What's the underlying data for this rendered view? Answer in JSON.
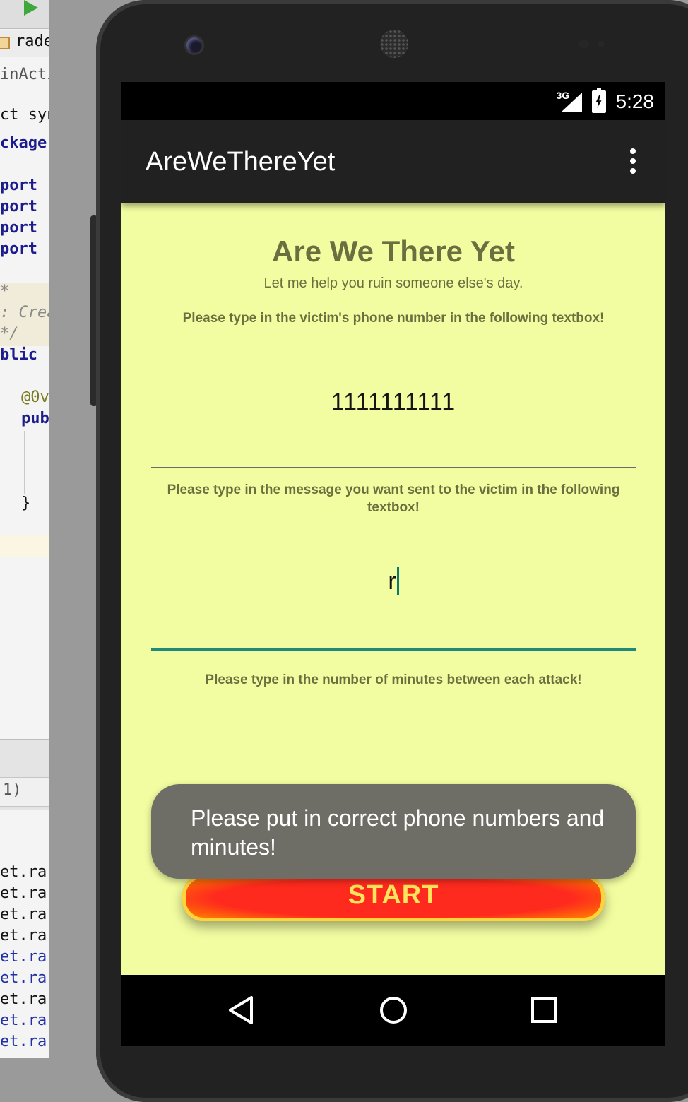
{
  "ide": {
    "tab_text": "rade",
    "file_text": "inActiv",
    "line1": "ct syn",
    "line2": "ckage",
    "imports": [
      "port",
      "port",
      "port",
      "port"
    ],
    "comment_open": "*",
    "comment_create": ": Crea",
    "comment_close": "*/",
    "public_kw": "blic",
    "annotation": "@0v",
    "pub_kw": "pub",
    "brace": "}",
    "panel_text": "1)",
    "log_lines": [
      "et.ra",
      "et.ra",
      "et.ra",
      "et.ra",
      "et.ra",
      "et.ra",
      "et.ra",
      "et.ra",
      "et.ra"
    ]
  },
  "status_bar": {
    "network": "3G",
    "time": "5:28"
  },
  "app_bar": {
    "title": "AreWeThereYet",
    "menu_icon": "overflow-menu-icon"
  },
  "main": {
    "heading": "Are We There Yet",
    "subheading": "Let me help you ruin someone else's day.",
    "phone_prompt": "Please type in the victim's phone number in the following textbox!",
    "phone_value": "1111111111",
    "message_prompt": "Please type in the message you want sent to the victim in the following textbox!",
    "message_value": "r",
    "minutes_prompt": "Please type in the number of minutes between each attack!",
    "start_label": "START"
  },
  "toast": {
    "message": "Please put in correct phone numbers and minutes!"
  },
  "nav_bar": {
    "back_icon": "back-icon",
    "home_icon": "home-icon",
    "recents_icon": "recents-icon"
  },
  "colors": {
    "screen_background": "#f2fca0",
    "app_bar": "#212121",
    "text_olive": "#6b6f40",
    "accent_teal": "#1f8a7c",
    "start_red": "#ff2a1e",
    "start_text": "#ffe45c",
    "toast_background": "#6e6e66"
  }
}
